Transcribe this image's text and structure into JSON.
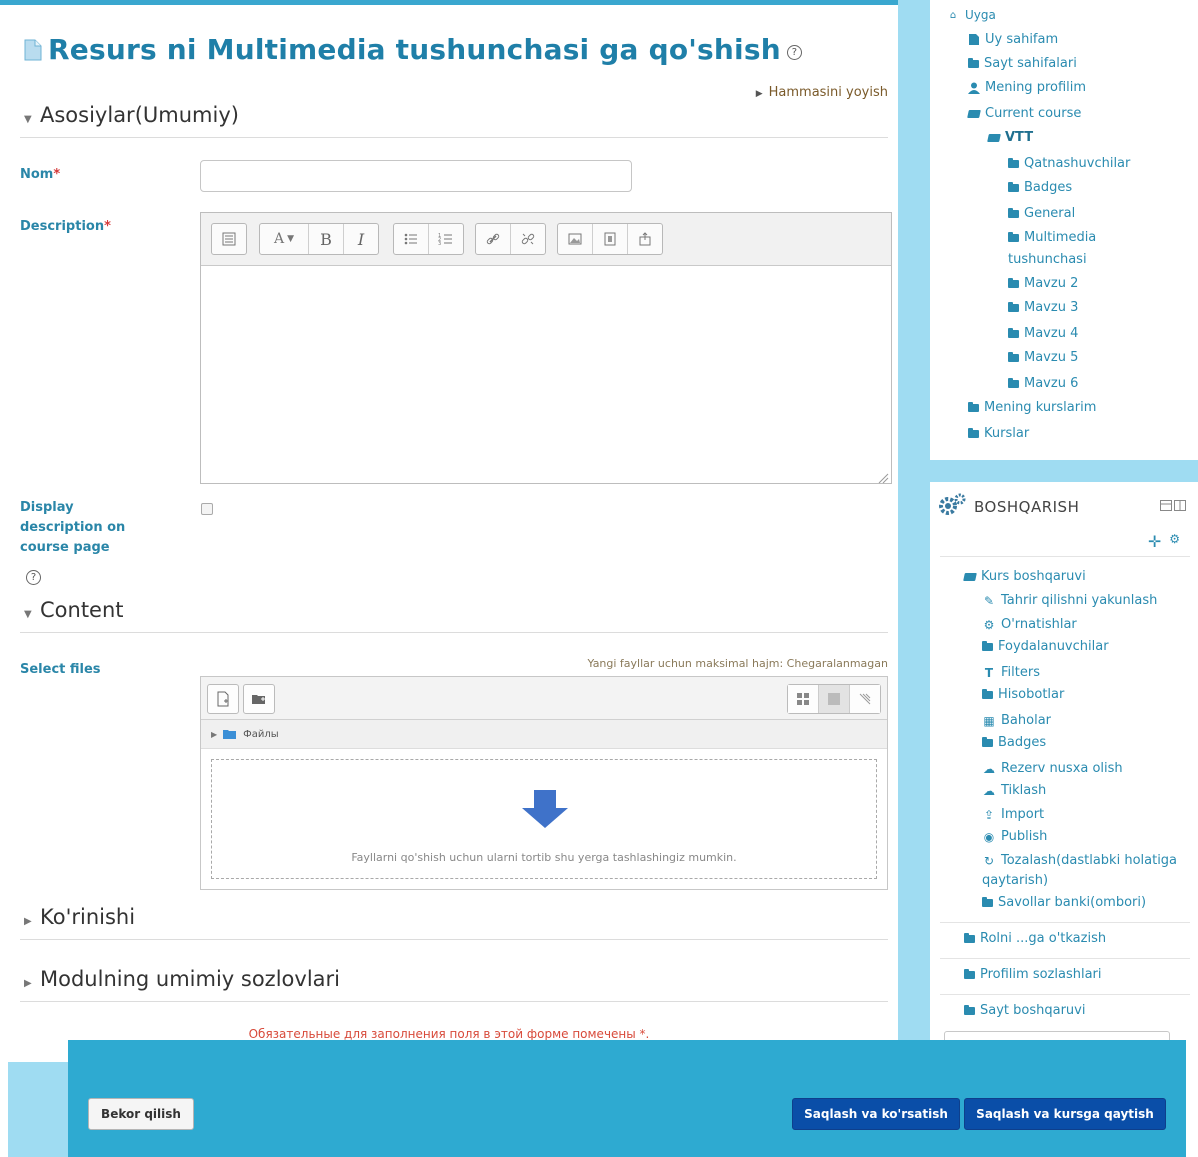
{
  "page": {
    "title": "Resurs ni Multimedia tushunchasi ga qo'shish",
    "expand_all": "Hammasini yoyish"
  },
  "sections": {
    "general": "Asosiylar(Umumiy)",
    "content": "Content",
    "appearance": "Ko'rinishi",
    "common": "Modulning umimiy sozlovlari"
  },
  "form": {
    "name_label": "Nom",
    "name_value": "",
    "description_label": "Description",
    "display_desc_label": "Display description on course page",
    "display_desc_checked": false,
    "select_files_label": "Select files",
    "max_size": "Yangi fayllar uchun maksimal hajm: Chegaralanmagan",
    "files_path": "Файлы",
    "dropzone_text": "Fayllarni qo'shish uchun ularni tortib shu yerga tashlashingiz mumkin.",
    "required_note": "Обязательные для заполнения поля в этой форме помечены *.",
    "required_mark": "*"
  },
  "editor": {
    "toolbar": [
      [
        "toggle-toolbar-icon"
      ],
      [
        "font-style-icon",
        "bold-icon",
        "italic-icon"
      ],
      [
        "bullet-list-icon",
        "numbered-list-icon"
      ],
      [
        "link-icon",
        "unlink-icon"
      ],
      [
        "image-icon",
        "media-icon",
        "manage-files-icon"
      ]
    ],
    "bold_glyph": "B",
    "italic_glyph": "I",
    "font_glyph": "A"
  },
  "navigation": {
    "items": [
      {
        "label": "Uyga",
        "icon": "home-icon",
        "level": 0
      },
      {
        "label": "Uy sahifam",
        "icon": "page-icon",
        "level": 1
      },
      {
        "label": "Sayt sahifalari",
        "icon": "folder-icon",
        "level": 1
      },
      {
        "label": "Mening profilim",
        "icon": "user-icon",
        "level": 1
      },
      {
        "label": "Current course",
        "icon": "open-folder-icon",
        "level": 1
      },
      {
        "label": "VTT",
        "icon": "open-folder-icon",
        "level": 2
      },
      {
        "label": "Qatnashuvchilar",
        "icon": "folder-icon",
        "level": 3
      },
      {
        "label": "Badges",
        "icon": "folder-icon",
        "level": 3
      },
      {
        "label": "General",
        "icon": "folder-icon",
        "level": 3
      },
      {
        "label": "Multimedia",
        "icon": "folder-icon",
        "level": 3
      },
      {
        "label": "tushunchasi",
        "icon": "",
        "level": 3
      },
      {
        "label": "Mavzu 2",
        "icon": "folder-icon",
        "level": 3
      },
      {
        "label": "Mavzu 3",
        "icon": "folder-icon",
        "level": 3
      },
      {
        "label": "Mavzu 4",
        "icon": "folder-icon",
        "level": 3
      },
      {
        "label": "Mavzu 5",
        "icon": "folder-icon",
        "level": 3
      },
      {
        "label": "Mavzu 6",
        "icon": "folder-icon",
        "level": 3
      },
      {
        "label": "Mening kurslarim",
        "icon": "folder-icon",
        "level": 1
      },
      {
        "label": "Kurslar",
        "icon": "folder-icon",
        "level": 1
      }
    ]
  },
  "admin": {
    "title": "BOSHQARISH",
    "items": [
      {
        "label": "Kurs boshqaruvi",
        "icon": "open-folder-icon"
      },
      {
        "label": "Tahrir qilishni yakunlash",
        "icon": "pencil-icon"
      },
      {
        "label": "O'rnatishlar",
        "icon": "gear-icon"
      },
      {
        "label": "Foydalanuvchilar",
        "icon": "folder-icon"
      },
      {
        "label": "Filters",
        "icon": "filter-icon"
      },
      {
        "label": "Hisobotlar",
        "icon": "folder-icon"
      },
      {
        "label": "Baholar",
        "icon": "grades-icon"
      },
      {
        "label": "Badges",
        "icon": "folder-icon"
      },
      {
        "label": "Rezerv nusxa olish",
        "icon": "backup-icon"
      },
      {
        "label": "Tiklash",
        "icon": "restore-icon"
      },
      {
        "label": "Import",
        "icon": "import-icon"
      },
      {
        "label": "Publish",
        "icon": "publish-icon"
      },
      {
        "label": "Tozalash(dastlabki holatiga",
        "icon": "reset-icon"
      },
      {
        "label": "qaytarish)",
        "icon": ""
      },
      {
        "label": "Savollar banki(ombori)",
        "icon": "folder-icon"
      }
    ],
    "switch_role": "Rolni ...ga o'tkazish",
    "profile_settings": "Profilim sozlashlari",
    "site_admin": "Sayt boshqaruvi",
    "search_value": ""
  },
  "footer": {
    "cancel": "Bekor qilish",
    "save_display": "Saqlash va ko'rsatish",
    "save_return": "Saqlash va kursga qaytish"
  },
  "colors": {
    "accent": "#2eaad1",
    "title": "#1f7fa8",
    "link": "#2a8bb0",
    "primary_button": "#0a4ea8",
    "required": "#d43a3a",
    "sidebar_bg": "#9fdcf2"
  }
}
